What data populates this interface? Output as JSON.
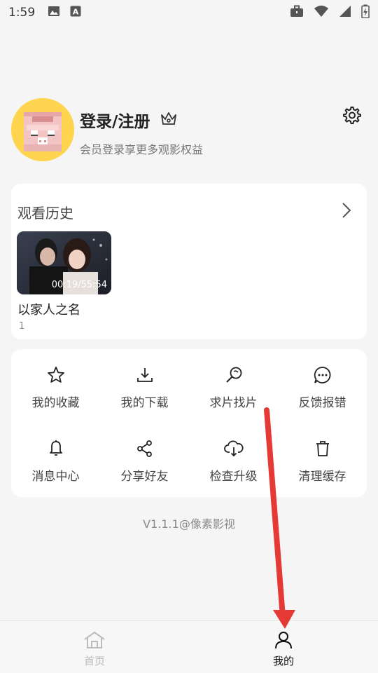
{
  "status_bar": {
    "time": "1:59"
  },
  "profile": {
    "title": "登录/注册",
    "subtitle": "会员登录享更多观影权益"
  },
  "history": {
    "title": "观看历史",
    "items": [
      {
        "name": "以家人之名",
        "episode": "1",
        "progress": "00:19/55:54"
      }
    ]
  },
  "menu": {
    "items": [
      {
        "label": "我的收藏",
        "icon": "star-icon"
      },
      {
        "label": "我的下载",
        "icon": "download-icon"
      },
      {
        "label": "求片找片",
        "icon": "search-icon"
      },
      {
        "label": "反馈报错",
        "icon": "feedback-icon"
      },
      {
        "label": "消息中心",
        "icon": "bell-icon"
      },
      {
        "label": "分享好友",
        "icon": "share-icon"
      },
      {
        "label": "检查升级",
        "icon": "cloud-download-icon"
      },
      {
        "label": "清理缓存",
        "icon": "trash-icon"
      }
    ]
  },
  "version": "V1.1.1@像素影视",
  "tabbar": {
    "tabs": [
      {
        "label": "首页",
        "icon": "home-icon",
        "active": false
      },
      {
        "label": "我的",
        "icon": "user-icon",
        "active": true
      }
    ]
  },
  "colors": {
    "annotation_arrow": "#e53935",
    "avatar_bg": "#ffd54f"
  }
}
